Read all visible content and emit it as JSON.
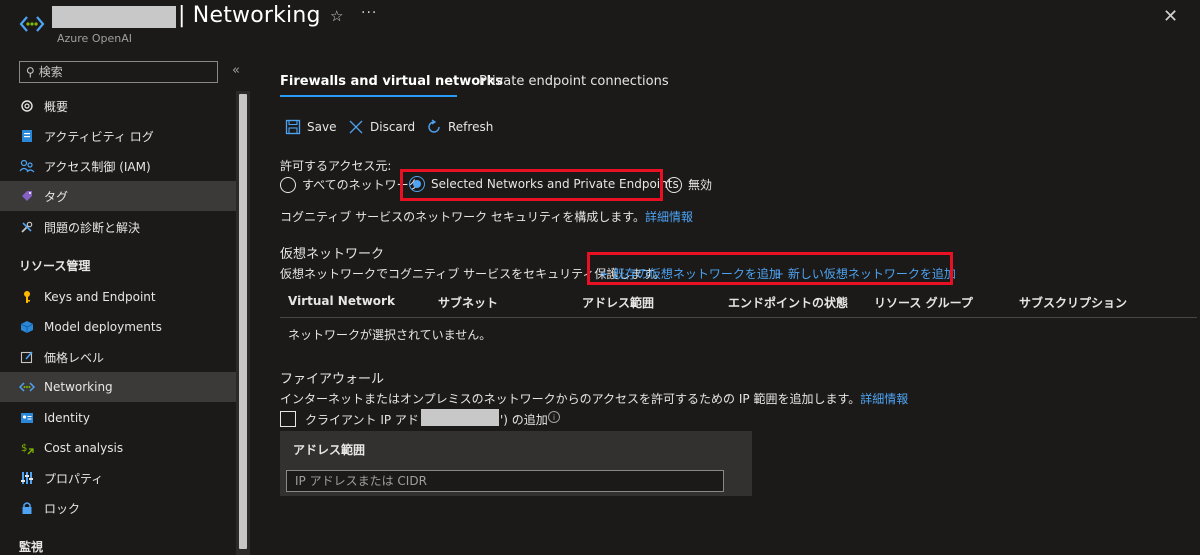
{
  "header": {
    "title": "| Networking",
    "subtitle": "Azure OpenAI"
  },
  "sidebar": {
    "search_placeholder": "検索",
    "items": [
      {
        "label": "概要",
        "icon": "openai-icon"
      },
      {
        "label": "アクティビティ ログ",
        "icon": "activity-log-icon"
      },
      {
        "label": "アクセス制御 (IAM)",
        "icon": "people-icon"
      },
      {
        "label": "タグ",
        "icon": "tag-icon"
      },
      {
        "label": "問題の診断と解決",
        "icon": "wrench-icon"
      }
    ],
    "section_resource": "リソース管理",
    "resource_items": [
      {
        "label": "Keys and Endpoint",
        "icon": "key-icon"
      },
      {
        "label": "Model deployments",
        "icon": "cube-icon"
      },
      {
        "label": "価格レベル",
        "icon": "edit-icon"
      },
      {
        "label": "Networking",
        "icon": "networking-icon"
      },
      {
        "label": "Identity",
        "icon": "identity-icon"
      },
      {
        "label": "Cost analysis",
        "icon": "cost-icon"
      },
      {
        "label": "プロパティ",
        "icon": "properties-icon"
      },
      {
        "label": "ロック",
        "icon": "lock-icon"
      }
    ],
    "section_monitor": "監視"
  },
  "tabs": [
    "Firewalls and virtual networks",
    "Private endpoint connections"
  ],
  "toolbar": {
    "save": "Save",
    "discard": "Discard",
    "refresh": "Refresh"
  },
  "access": {
    "label": "許可するアクセス元:",
    "options": [
      "すべてのネットワーク",
      "Selected Networks and Private Endpoints",
      "無効"
    ],
    "selected": "Selected Networks and Private Endpoints",
    "description": "コグニティブ サービスのネットワーク セキュリティを構成します。",
    "learn_more": "詳細情報"
  },
  "vnet": {
    "heading": "仮想ネットワーク",
    "description": "仮想ネットワークでコグニティブ サービスをセキュリティ保護します。",
    "add_existing": "+ 既存の仮想ネットワークを追加",
    "add_new": "+ 新しい仮想ネットワークを追加",
    "columns": [
      "Virtual Network",
      "サブネット",
      "アドレス範囲",
      "エンドポイントの状態",
      "リソース グループ",
      "サブスクリプション"
    ],
    "empty": "ネットワークが選択されていません。"
  },
  "firewall": {
    "heading": "ファイアウォール",
    "description": "インターネットまたはオンプレミスのネットワークからのアクセスを許可するための IP 範囲を追加します。",
    "learn_more": "詳細情報",
    "client_ip_prefix": "クライアント IP アドレス ('",
    "client_ip_suffix": "') の追加",
    "address_header": "アドレス範囲",
    "address_placeholder": "IP アドレスまたは CIDR"
  },
  "colors": {
    "accent": "#4ea3f2",
    "highlight": "#e81123",
    "background": "#1b1a19"
  }
}
